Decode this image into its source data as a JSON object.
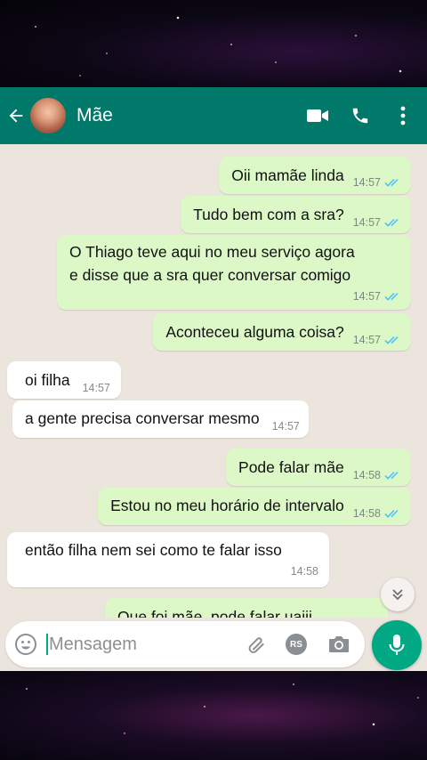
{
  "header": {
    "contact_name": "Mãe",
    "icons": [
      "back-arrow-icon",
      "video-call-icon",
      "voice-call-icon",
      "more-options-icon"
    ]
  },
  "messages": [
    {
      "dir": "out",
      "text": "Oii mamãe linda",
      "time": "14:57"
    },
    {
      "dir": "out",
      "text": "Tudo bem com a sra?",
      "time": "14:57"
    },
    {
      "dir": "out",
      "text": "O Thiago teve aqui no meu serviço agora\ne disse que a sra quer conversar comigo",
      "time": "14:57"
    },
    {
      "dir": "out",
      "text": "Aconteceu alguma coisa?",
      "time": "14:57"
    },
    {
      "dir": "in",
      "text": "oi filha",
      "time": "14:57"
    },
    {
      "dir": "in",
      "text": "a gente precisa conversar mesmo",
      "time": "14:57"
    },
    {
      "dir": "out",
      "text": "Pode falar mãe",
      "time": "14:58"
    },
    {
      "dir": "out",
      "text": "Estou no meu horário de intervalo",
      "time": "14:58"
    },
    {
      "dir": "in",
      "text": "então filha nem sei como te falar isso",
      "time": "14:58"
    },
    {
      "dir": "out",
      "text": "Que foi mãe, pode falar uaiii",
      "time": ""
    }
  ],
  "composer": {
    "placeholder": "Mensagem",
    "rs_badge": "RS"
  },
  "colors": {
    "header": "#00796b",
    "outgoing_bubble": "#dcf8c6",
    "incoming_bubble": "#ffffff",
    "chat_bg": "#ece5dd",
    "read_ticks": "#4fc3f7",
    "mic_button": "#00a884"
  }
}
